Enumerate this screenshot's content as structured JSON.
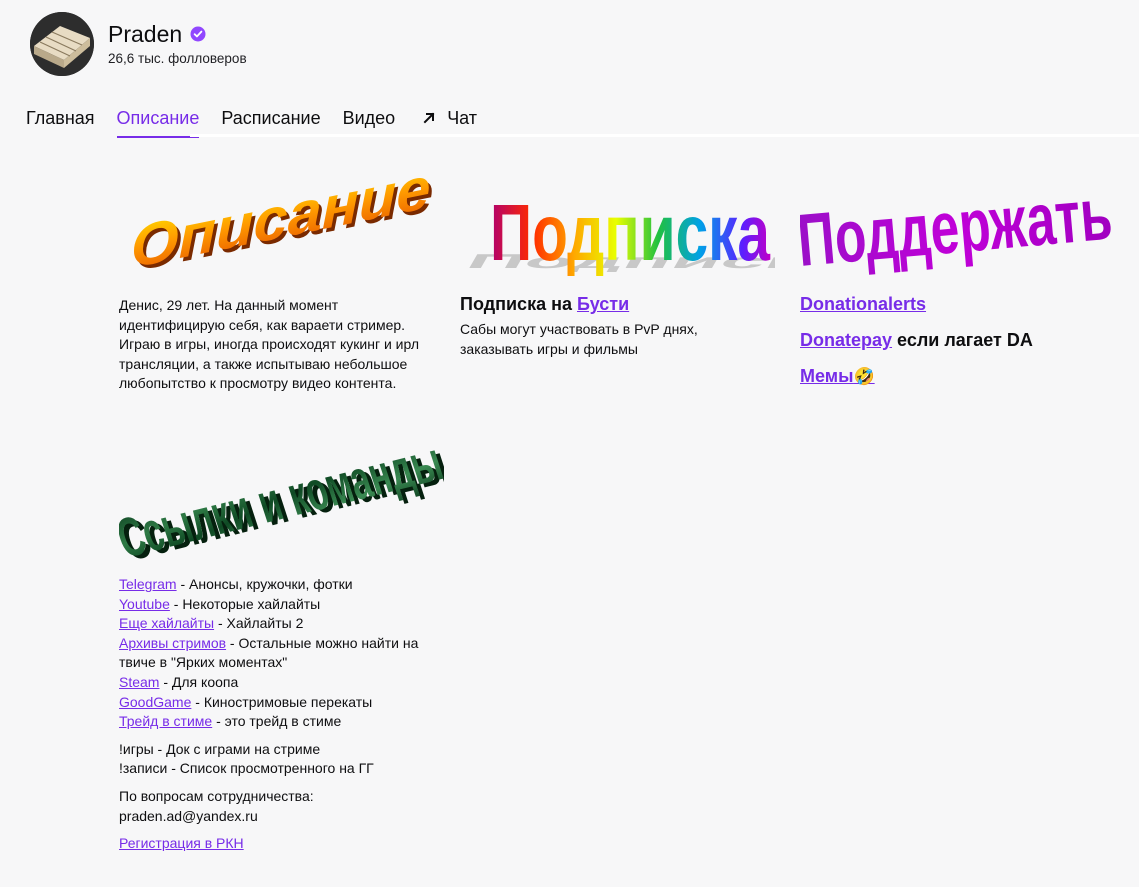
{
  "channel": {
    "name": "Praden",
    "followers": "26,6 тыс. фолловеров",
    "accent": "#772ce8"
  },
  "tabs": [
    {
      "label": "Главная"
    },
    {
      "label": "Описание",
      "active": true
    },
    {
      "label": "Расписание"
    },
    {
      "label": "Видео"
    },
    {
      "label": "Чат",
      "icon": "external-arrow-icon"
    }
  ],
  "panels": {
    "about": {
      "image_text": "Описание",
      "text": "Денис, 29 лет. На данный момент идентифицирую себя, как варaети стример. Играю в игры, иногда происходят кукинг и ирл трансляции, а также испытываю небольшое любопытство к просмотру видео контента."
    },
    "subscribe": {
      "image_text": "Подписка",
      "title_prefix": "Подписка на",
      "title_link": "Бусти",
      "text": "Сабы могут участвовать в PvP днях, заказывать игры и фильмы"
    },
    "support": {
      "image_text": "Поддержать",
      "link1": "Donationalerts",
      "link2": "Donatepay",
      "link2_suffix": "если лагает DA",
      "link3": "Мемы",
      "emoji": "🤣"
    },
    "links": {
      "image_text": "Ссылки и команды",
      "items": [
        {
          "link": "Telegram",
          "text": " - Анонсы, кружочки, фотки"
        },
        {
          "link": "Youtube",
          "text": " - Некоторые хайлайты"
        },
        {
          "link": "Еще хайлайты",
          "text": " - Хайлайты 2"
        },
        {
          "link": "Архивы стримов",
          "text": " - Остальные можно найти на твиче в \"Ярких моментах\""
        },
        {
          "link": "Steam",
          "text": " - Для коопа"
        },
        {
          "link": "GoodGame",
          "text": " - Кинострим­овые перекаты"
        },
        {
          "link": "Трейд в стиме",
          "text": " - это трейд в стиме"
        }
      ],
      "commands": [
        "!игры - Док с играми на стриме",
        "!записи - Список просмотренного на ГГ"
      ],
      "contact_label": "По вопросам сотрудничества:",
      "contact_email": "praden.ad@yandex.ru",
      "rkn_link": "Регистрация в РКН"
    }
  }
}
